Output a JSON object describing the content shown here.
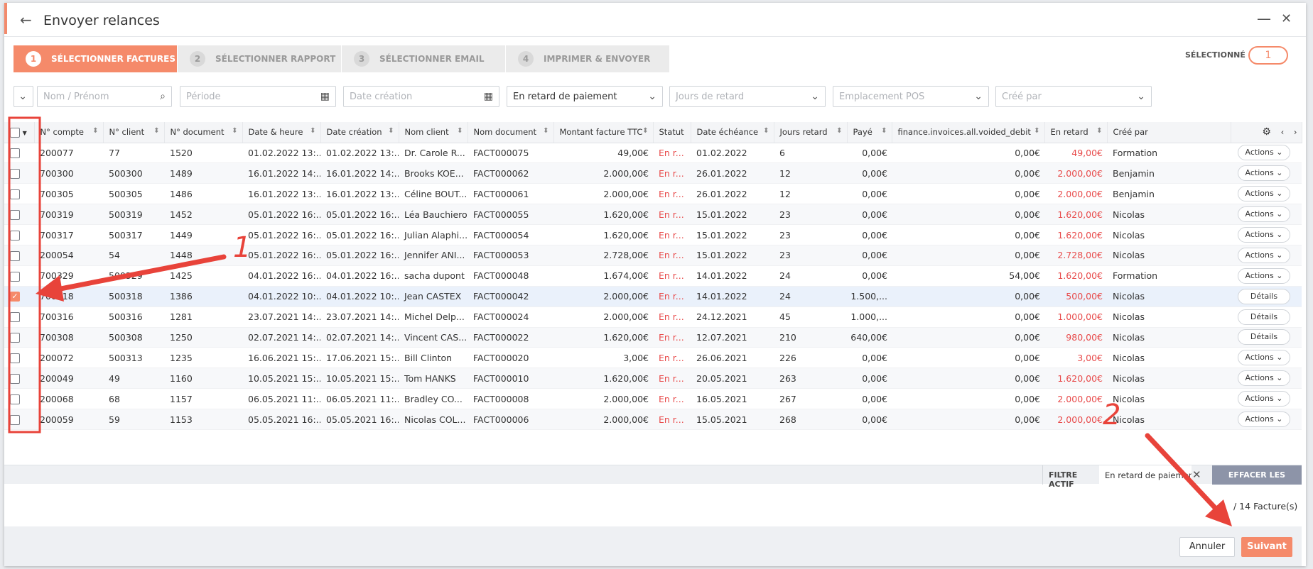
{
  "window": {
    "title": "Envoyer relances"
  },
  "steps": [
    {
      "num": "1",
      "label": "SÉLECTIONNER FACTURES",
      "active": true
    },
    {
      "num": "2",
      "label": "SÉLECTIONNER RAPPORT",
      "active": false
    },
    {
      "num": "3",
      "label": "SÉLECTIONNER EMAIL",
      "active": false
    },
    {
      "num": "4",
      "label": "IMPRIMER & ENVOYER",
      "active": false
    }
  ],
  "selected": {
    "label": "SÉLECTIONNÉ",
    "count": "1"
  },
  "filters": {
    "name_placeholder": "Nom / Prénom",
    "period_placeholder": "Période",
    "creation_placeholder": "Date création",
    "status_value": "En retard de paiement",
    "days_placeholder": "Jours de retard",
    "pos_placeholder": "Emplacement POS",
    "creator_placeholder": "Créé par"
  },
  "columns": [
    "N° compte",
    "N° client",
    "N° document",
    "Date & heure",
    "Date création",
    "Nom client",
    "Nom document",
    "Montant facture TTC",
    "Statut",
    "Date échéance",
    "Jours retard",
    "Payé",
    "finance.invoices.all.voided_debit",
    "En retard",
    "Créé par"
  ],
  "rows": [
    {
      "account": "200077",
      "client": "77",
      "doc": "1520",
      "datetime": "01.02.2022 13:...",
      "created": "01.02.2022 13:...",
      "name": "Dr. Carole R...",
      "docname": "FACT000075",
      "amount": "49,00€",
      "status": "En r...",
      "due": "01.02.2022",
      "days": "6",
      "paid": "0,00€",
      "voided": "0,00€",
      "late": "49,00€",
      "creator": "Formation",
      "action": "Actions",
      "checked": false
    },
    {
      "account": "700300",
      "client": "500300",
      "doc": "1489",
      "datetime": "16.01.2022 14:...",
      "created": "16.01.2022 14:...",
      "name": "Brooks KOE...",
      "docname": "FACT000062",
      "amount": "2.000,00€",
      "status": "En r...",
      "due": "26.01.2022",
      "days": "12",
      "paid": "0,00€",
      "voided": "0,00€",
      "late": "2.000,00€",
      "creator": "Benjamin",
      "action": "Actions",
      "checked": false
    },
    {
      "account": "700305",
      "client": "500305",
      "doc": "1486",
      "datetime": "16.01.2022 13:...",
      "created": "16.01.2022 13:...",
      "name": "Céline BOUT...",
      "docname": "FACT000061",
      "amount": "2.000,00€",
      "status": "En r...",
      "due": "26.01.2022",
      "days": "12",
      "paid": "0,00€",
      "voided": "0,00€",
      "late": "2.000,00€",
      "creator": "Benjamin",
      "action": "Actions",
      "checked": false
    },
    {
      "account": "700319",
      "client": "500319",
      "doc": "1452",
      "datetime": "05.01.2022 16:...",
      "created": "05.01.2022 16:...",
      "name": "Léa Bauchiero",
      "docname": "FACT000055",
      "amount": "1.620,00€",
      "status": "En r...",
      "due": "15.01.2022",
      "days": "23",
      "paid": "0,00€",
      "voided": "0,00€",
      "late": "1.620,00€",
      "creator": "Nicolas",
      "action": "Actions",
      "checked": false
    },
    {
      "account": "700317",
      "client": "500317",
      "doc": "1449",
      "datetime": "05.01.2022 16:...",
      "created": "05.01.2022 16:...",
      "name": "Julian Alaphi...",
      "docname": "FACT000054",
      "amount": "1.620,00€",
      "status": "En r...",
      "due": "15.01.2022",
      "days": "23",
      "paid": "0,00€",
      "voided": "0,00€",
      "late": "1.620,00€",
      "creator": "Nicolas",
      "action": "Actions",
      "checked": false
    },
    {
      "account": "200054",
      "client": "54",
      "doc": "1448",
      "datetime": "05.01.2022 16:...",
      "created": "05.01.2022 16:...",
      "name": "Jennifer ANI...",
      "docname": "FACT000053",
      "amount": "2.728,00€",
      "status": "En r...",
      "due": "15.01.2022",
      "days": "23",
      "paid": "0,00€",
      "voided": "0,00€",
      "late": "2.728,00€",
      "creator": "Nicolas",
      "action": "Actions",
      "checked": false
    },
    {
      "account": "700329",
      "client": "500329",
      "doc": "1425",
      "datetime": "04.01.2022 16:...",
      "created": "04.01.2022 16:...",
      "name": "sacha dupont",
      "docname": "FACT000048",
      "amount": "1.674,00€",
      "status": "En r...",
      "due": "14.01.2022",
      "days": "24",
      "paid": "0,00€",
      "voided": "54,00€",
      "late": "1.620,00€",
      "creator": "Formation",
      "action": "Actions",
      "checked": false
    },
    {
      "account": "700318",
      "client": "500318",
      "doc": "1386",
      "datetime": "04.01.2022 10:...",
      "created": "04.01.2022 10:...",
      "name": "Jean CASTEX",
      "docname": "FACT000042",
      "amount": "2.000,00€",
      "status": "En r...",
      "due": "14.01.2022",
      "days": "24",
      "paid": "1.500,...",
      "voided": "0,00€",
      "late": "500,00€",
      "creator": "Nicolas",
      "action": "Détails",
      "checked": true
    },
    {
      "account": "700316",
      "client": "500316",
      "doc": "1281",
      "datetime": "23.07.2021 14:...",
      "created": "23.07.2021 14:...",
      "name": "Michel Delp...",
      "docname": "FACT000024",
      "amount": "2.000,00€",
      "status": "En r...",
      "due": "24.12.2021",
      "days": "45",
      "paid": "1.000,...",
      "voided": "0,00€",
      "late": "1.000,00€",
      "creator": "Nicolas",
      "action": "Détails",
      "checked": false
    },
    {
      "account": "700308",
      "client": "500308",
      "doc": "1250",
      "datetime": "02.07.2021 14:...",
      "created": "02.07.2021 14:...",
      "name": "Vincent CAS...",
      "docname": "FACT000022",
      "amount": "1.620,00€",
      "status": "En r...",
      "due": "12.07.2021",
      "days": "210",
      "paid": "640,00€",
      "voided": "0,00€",
      "late": "980,00€",
      "creator": "Nicolas",
      "action": "Détails",
      "checked": false
    },
    {
      "account": "200072",
      "client": "500313",
      "doc": "1235",
      "datetime": "16.06.2021 15:...",
      "created": "17.06.2021 15:...",
      "name": "Bill Clinton",
      "docname": "FACT000020",
      "amount": "3,00€",
      "status": "En r...",
      "due": "26.06.2021",
      "days": "226",
      "paid": "0,00€",
      "voided": "0,00€",
      "late": "3,00€",
      "creator": "Nicolas",
      "action": "Actions",
      "checked": false
    },
    {
      "account": "200049",
      "client": "49",
      "doc": "1160",
      "datetime": "10.05.2021 15:...",
      "created": "10.05.2021 15:...",
      "name": "Tom HANKS",
      "docname": "FACT000010",
      "amount": "1.620,00€",
      "status": "En r...",
      "due": "20.05.2021",
      "days": "263",
      "paid": "0,00€",
      "voided": "0,00€",
      "late": "1.620,00€",
      "creator": "Nicolas",
      "action": "Actions",
      "checked": false
    },
    {
      "account": "200068",
      "client": "68",
      "doc": "1157",
      "datetime": "06.05.2021 11:...",
      "created": "06.05.2021 11:...",
      "name": "Bradley CO...",
      "docname": "FACT000008",
      "amount": "2.000,00€",
      "status": "En r...",
      "due": "16.05.2021",
      "days": "267",
      "paid": "0,00€",
      "voided": "0,00€",
      "late": "2.000,00€",
      "creator": "Nicolas",
      "action": "Actions",
      "checked": false
    },
    {
      "account": "200059",
      "client": "59",
      "doc": "1153",
      "datetime": "05.05.2021 16:...",
      "created": "05.05.2021 16:...",
      "name": "Nicolas COL...",
      "docname": "FACT000006",
      "amount": "2.000,00€",
      "status": "En r...",
      "due": "15.05.2021",
      "days": "268",
      "paid": "0,00€",
      "voided": "0,00€",
      "late": "2.000,00€",
      "creator": "Nicolas",
      "action": "Actions",
      "checked": false
    }
  ],
  "active_filter": {
    "label": "FILTRE ACTIF",
    "value": "En retard de paiement",
    "clear": "EFFACER LES FILTRES"
  },
  "count_text": "/ 14 Facture(s)",
  "footer": {
    "cancel": "Annuler",
    "next": "Suivant"
  },
  "annotations": {
    "one": "1",
    "two": "2"
  },
  "colors": {
    "accent": "#f58a6a",
    "late_red": "#e84a4a",
    "annotation_red": "#e8433a"
  }
}
